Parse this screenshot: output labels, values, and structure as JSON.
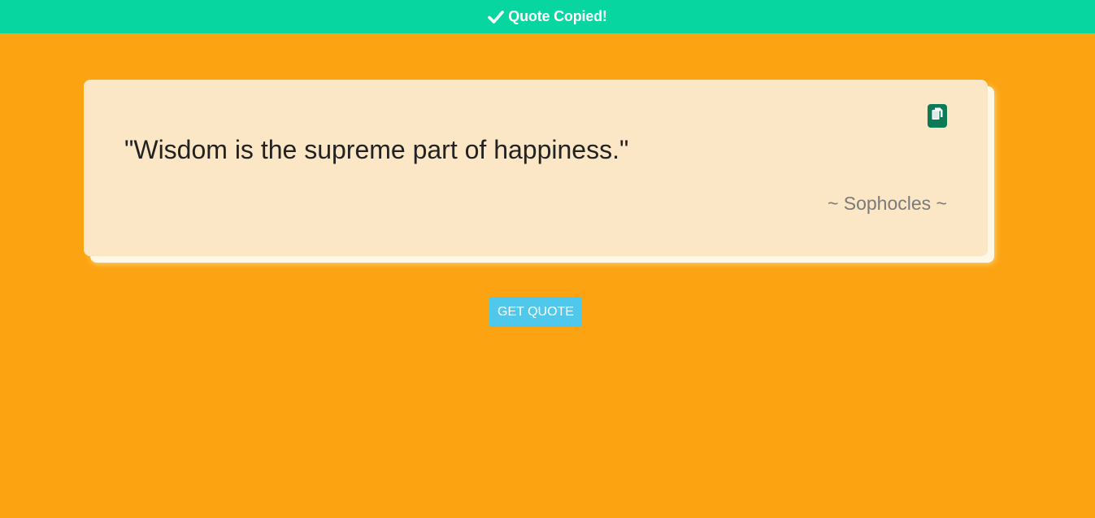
{
  "toast": {
    "icon": "check-icon",
    "message": "Quote Copied!",
    "color": "#08D6A0"
  },
  "quote_card": {
    "text": "\"Wisdom is the supreme part of happiness.\"",
    "author": "~ Sophocles ~",
    "copy_button_icon": "copy-icon",
    "background": "#FBE7C6"
  },
  "actions": {
    "get_quote_label": "GET QUOTE",
    "button_color": "#4FC8EC"
  },
  "page": {
    "background": "#FCA311"
  }
}
